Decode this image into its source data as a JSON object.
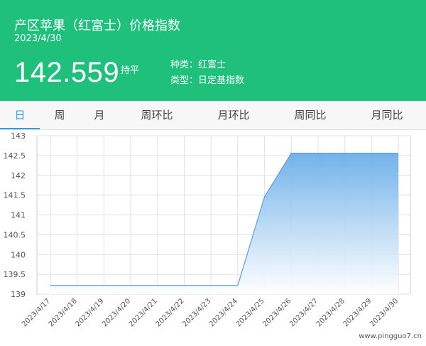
{
  "header": {
    "title": "产区苹果（红富士）价格指数",
    "date": "2023/4/30",
    "price": "142.559",
    "trend": "持平",
    "variety": "种类：红富士",
    "index_type": "类型：日定基指数"
  },
  "tabs": [
    {
      "label": "日"
    },
    {
      "label": "周"
    },
    {
      "label": "月"
    },
    {
      "label": "周环比"
    },
    {
      "label": "月环比"
    },
    {
      "label": "周同比"
    },
    {
      "label": "月同比"
    }
  ],
  "watermark": "www.pingguo7.cn",
  "colors": {
    "header": "#1fbf7c",
    "tab_active": "#2a9ff0",
    "area_top": "#6aaee9",
    "line": "#5a9fe0"
  },
  "chart_data": {
    "type": "area",
    "x": [
      "2023/4/17",
      "2023/4/18",
      "2023/4/19",
      "2023/4/20",
      "2023/4/21",
      "2023/4/22",
      "2023/4/23",
      "2023/4/24",
      "2023/4/25",
      "2023/4/26",
      "2023/4/27",
      "2023/4/28",
      "2023/4/29",
      "2023/4/30"
    ],
    "series": [
      {
        "values": [
          139.22,
          139.22,
          139.22,
          139.22,
          139.22,
          139.22,
          139.22,
          139.22,
          141.46,
          142.559,
          142.559,
          142.559,
          142.559,
          142.559
        ]
      }
    ],
    "yticks": [
      "139",
      "139.5",
      "140",
      "140.5",
      "141",
      "141.5",
      "142",
      "142.5",
      "143"
    ],
    "ylim": [
      139,
      143
    ],
    "grid": true
  }
}
